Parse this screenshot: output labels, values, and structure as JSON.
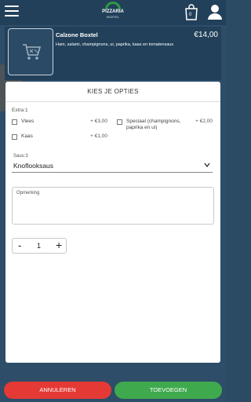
{
  "header": {
    "logo_name": "PIZZARIA",
    "logo_sub": "BOXTEL",
    "cart_count": "0",
    "icons": [
      "menu-icon",
      "shopping-bag-icon",
      "user-icon"
    ]
  },
  "product": {
    "name": "Calzone Boxtel",
    "price": "€14,00",
    "description": "Ham, salami, champignons, ui, paprika, kaas en tomatensaus",
    "image_icon": "cart-placeholder-icon"
  },
  "options": {
    "title": "KIES JE OPTIES",
    "extra_label": "Extra:1",
    "items": [
      {
        "label": "Vlees",
        "price": "+ €3,00"
      },
      {
        "label": "Kaas",
        "price": "+ €1,00"
      },
      {
        "label": "Speciaal (champignons, paprika en ui)",
        "price": "+ €2,00"
      }
    ],
    "sauce_label": "Saus:3",
    "sauce_value": "Knoflooksaus",
    "remark_label": "Opmerking",
    "quantity": "1",
    "minus": "-",
    "plus": "+"
  },
  "buttons": {
    "cancel": "ANNULEREN",
    "add": "TOEVOEGEN"
  },
  "colors": {
    "header_bg": "#22405a",
    "cancel": "#e53935",
    "add": "#3fa94e"
  }
}
